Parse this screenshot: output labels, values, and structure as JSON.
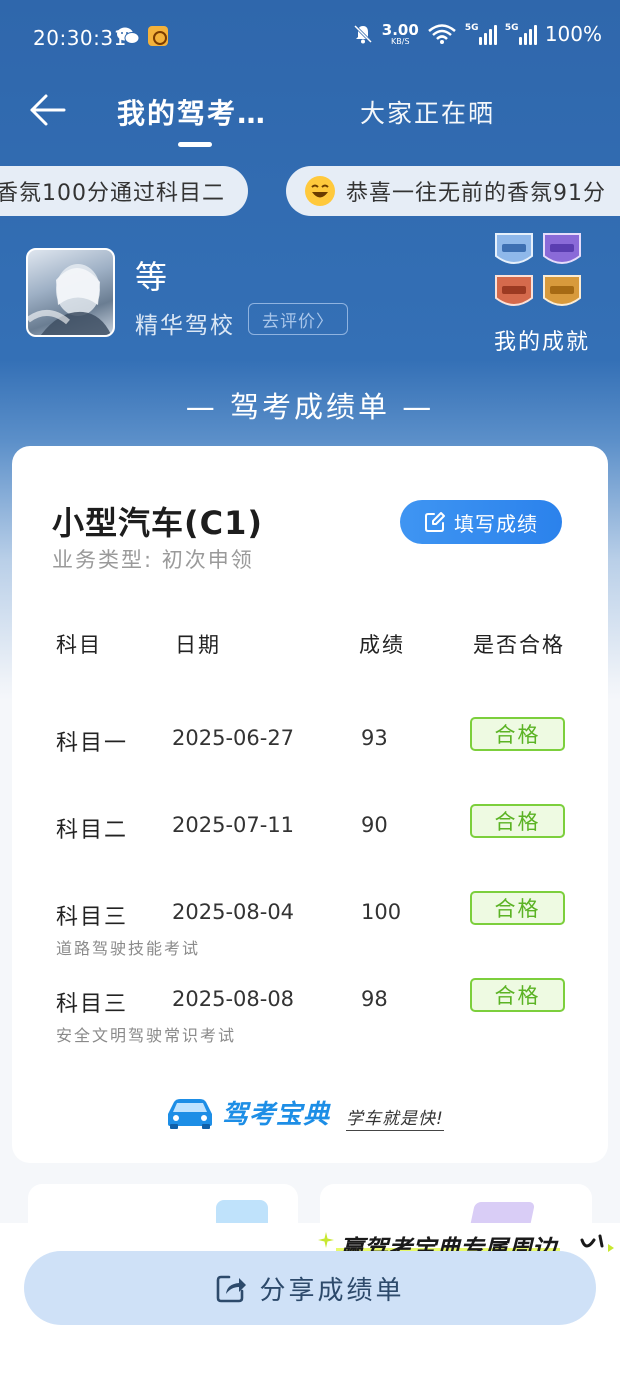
{
  "status_bar": {
    "time": "20:30:31",
    "speed_value": "3.00",
    "speed_unit": "KB/S",
    "net_1": "5G",
    "net_2": "5G",
    "battery": "100%"
  },
  "nav": {
    "tab_mine": "我的驾考…",
    "tab_others": "大家正在晒"
  },
  "ticker": [
    "香氛100分通过科目二",
    "恭喜一往无前的香氛91分"
  ],
  "profile": {
    "name": "等",
    "school": "精华驾校",
    "review_label": "去评价〉",
    "achievements_label": "我的成就"
  },
  "section_title": "— 驾考成绩单 —",
  "card": {
    "license_type": "小型汽车(C1)",
    "business_type": "业务类型:  初次申领",
    "fill_button_label": "填写成绩",
    "headers": {
      "subject": "科目",
      "date": "日期",
      "score": "成绩",
      "pass": "是否合格"
    },
    "rows": [
      {
        "subject": "科目一",
        "sub": "",
        "date": "2025-06-27",
        "score": "93",
        "result": "合格"
      },
      {
        "subject": "科目二",
        "sub": "",
        "date": "2025-07-11",
        "score": "90",
        "result": "合格"
      },
      {
        "subject": "科目三",
        "sub": "道路驾驶技能考试",
        "date": "2025-08-04",
        "score": "100",
        "result": "合格"
      },
      {
        "subject": "科目三",
        "sub": "安全文明驾驶常识考试",
        "date": "2025-08-08",
        "score": "98",
        "result": "合格"
      }
    ],
    "brand_name": "驾考宝典",
    "brand_slogan": "学车就是快!"
  },
  "promo": {
    "banner_text": "赢驾考宝典专属周边"
  },
  "share_label": "分享成绩单",
  "colors": {
    "header_blue": "#2f67ac",
    "button_blue": "#2b82ec",
    "pass_green": "#5bb324",
    "share_bg": "#cfe1f7"
  }
}
